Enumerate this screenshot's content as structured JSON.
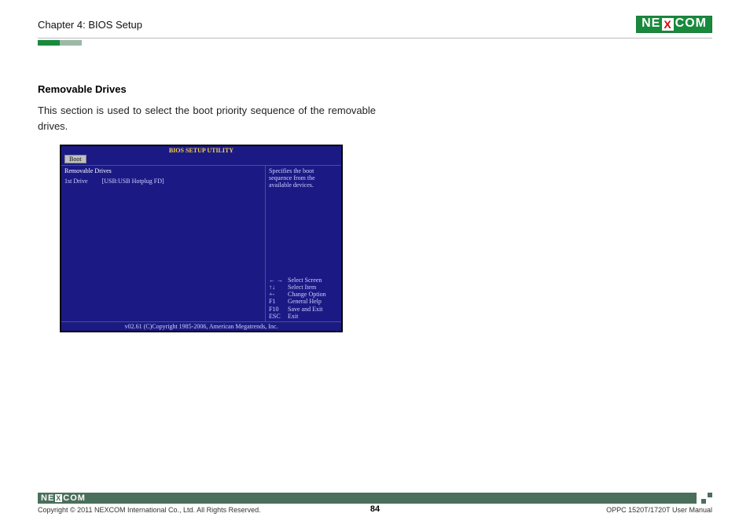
{
  "header": {
    "chapter": "Chapter 4: BIOS Setup",
    "logo_pre": "NE",
    "logo_x": "X",
    "logo_post": "COM"
  },
  "section": {
    "title": "Removable Drives",
    "desc": "This section is used to select the boot priority sequence of the removable drives."
  },
  "bios": {
    "title": "BIOS SETUP UTILITY",
    "tab": "Boot",
    "left_header": "Removable Drives",
    "row_label": "1st Drive",
    "row_value": "[USB:USB Hotplug FD]",
    "help": "Specifies the boot sequence from the available devices.",
    "keys": [
      {
        "k": "← →",
        "v": "Select Screen"
      },
      {
        "k": "↑↓",
        "v": "Select Item"
      },
      {
        "k": "+-",
        "v": "Change Option"
      },
      {
        "k": "F1",
        "v": "General Help"
      },
      {
        "k": "F10",
        "v": "Save and Exit"
      },
      {
        "k": "ESC",
        "v": "Exit"
      }
    ],
    "footer": "v02.61 (C)Copyright 1985-2006, American Megatrends, Inc."
  },
  "footer": {
    "copyright": "Copyright © 2011 NEXCOM International Co., Ltd. All Rights Reserved.",
    "manual": "OPPC 1520T/1720T User Manual",
    "page": "84",
    "logo_pre": "NE",
    "logo_x": "X",
    "logo_post": "COM"
  }
}
